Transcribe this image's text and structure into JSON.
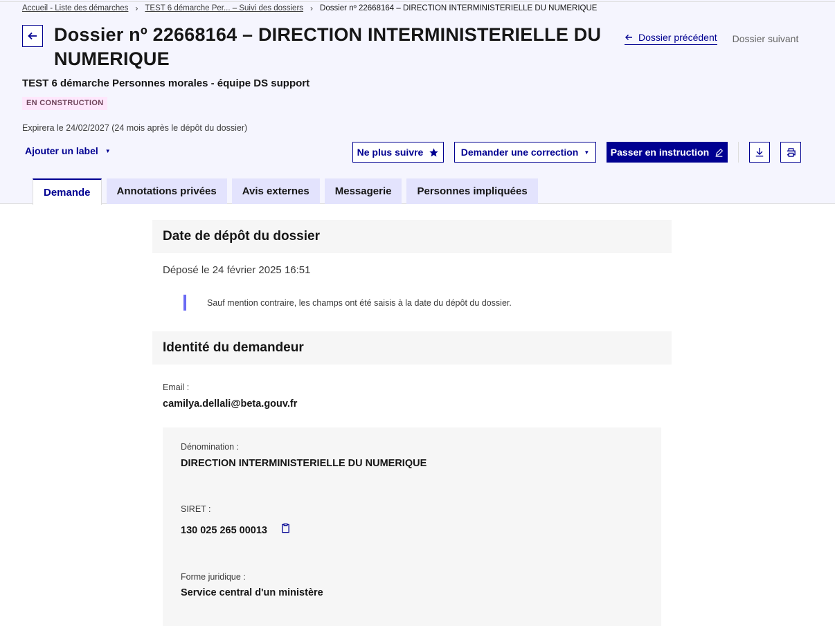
{
  "breadcrumb": {
    "item1": "Accueil - Liste des démarches",
    "item2": "TEST 6 démarche Per... – Suivi des dossiers",
    "current": "Dossier nº 22668164 – DIRECTION INTERMINISTERIELLE DU NUMERIQUE"
  },
  "header": {
    "title": "Dossier nº 22668164 – DIRECTION INTERMINISTERIELLE DU NUMERIQUE",
    "subtitle": "TEST 6 démarche Personnes morales - équipe DS support",
    "status_badge": "EN CONSTRUCTION",
    "expiry": "Expirera le 24/02/2027 (24 mois après le dépôt du dossier)",
    "prev_link": "Dossier précédent",
    "next_link": "Dossier suivant"
  },
  "toolbar": {
    "label_dropdown": "Ajouter un label",
    "unfollow": "Ne plus suivre",
    "request_correction": "Demander une correction",
    "start_instruction": "Passer en instruction"
  },
  "tabs": [
    {
      "label": "Demande",
      "active": true
    },
    {
      "label": "Annotations privées"
    },
    {
      "label": "Avis externes"
    },
    {
      "label": "Messagerie"
    },
    {
      "label": "Personnes impliquées"
    }
  ],
  "deposit": {
    "heading": "Date de dépôt du dossier",
    "text": "Déposé le 24 février 2025 16:51",
    "notice": "Sauf mention contraire, les champs ont été saisis à la date du dépôt du dossier."
  },
  "identity": {
    "heading": "Identité du demandeur",
    "email_label": "Email :",
    "email_value": "camilya.dellali@beta.gouv.fr",
    "denomination_label": "Dénomination :",
    "denomination_value": "DIRECTION INTERMINISTERIELLE DU NUMERIQUE",
    "siret_label": "SIRET :",
    "siret_value": "130 025 265 00013",
    "forme_label": "Forme juridique :",
    "forme_value": "Service central d'un ministère"
  },
  "colors": {
    "primary": "#000091",
    "header_bg": "#f5f5fe",
    "tab_bg": "#e3e3fd",
    "badge_bg": "#fee7fc",
    "badge_text": "#6e445a",
    "notice_border": "#6a6af4"
  },
  "icons": [
    "arrow-left-icon",
    "star-icon",
    "pencil-icon",
    "download-icon",
    "printer-icon",
    "clipboard-icon",
    "chevron-right-icon",
    "caret-down-icon"
  ]
}
